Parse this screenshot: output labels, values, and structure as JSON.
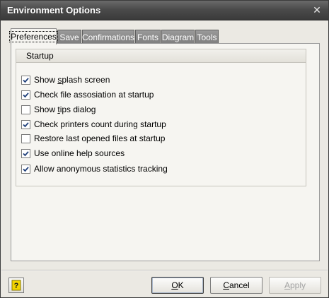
{
  "window": {
    "title": "Environment Options",
    "close_glyph": "✕"
  },
  "tabs": [
    {
      "label": "Preferences",
      "active": true
    },
    {
      "label": "Save",
      "active": false
    },
    {
      "label": "Confirmations",
      "active": false
    },
    {
      "label": "Fonts",
      "active": false
    },
    {
      "label": "Diagram",
      "active": false
    },
    {
      "label": "Tools",
      "active": false
    }
  ],
  "startup": {
    "header": "Startup",
    "options": [
      {
        "pre": "Show ",
        "u": "s",
        "post": "plash screen",
        "checked": true
      },
      {
        "pre": "Check file assosiation at startup",
        "u": "",
        "post": "",
        "checked": true
      },
      {
        "pre": "Show ",
        "u": "t",
        "post": "ips dialog",
        "checked": false
      },
      {
        "pre": "Check printers count during startup",
        "u": "",
        "post": "",
        "checked": true
      },
      {
        "pre": "Restore last opened files at startup",
        "u": "",
        "post": "",
        "checked": false
      },
      {
        "pre": "Use online help sources",
        "u": "",
        "post": "",
        "checked": true
      },
      {
        "pre": "Allow anonymous statistics tracking",
        "u": "",
        "post": "",
        "checked": true
      }
    ]
  },
  "buttons": {
    "ok": {
      "u": "O",
      "post": "K"
    },
    "cancel": {
      "u": "C",
      "post": "ancel"
    },
    "apply": {
      "u": "A",
      "post": "pply",
      "enabled": false
    }
  },
  "colors": {
    "title_bar": "#4b4b4b",
    "check_mark": "#1f3f7a",
    "help_icon": "#f2d400"
  },
  "icons": {
    "help": "help-icon",
    "close": "close-icon",
    "check": "check-icon"
  }
}
